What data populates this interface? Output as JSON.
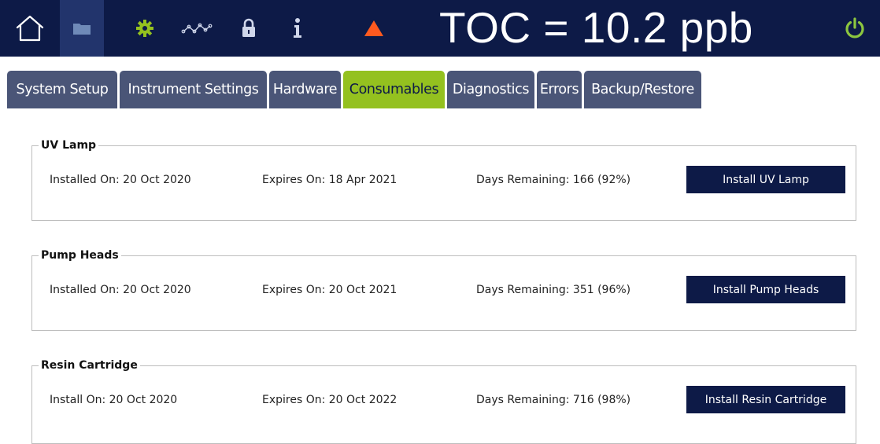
{
  "topbar": {
    "toc_reading": "TOC = 10.2 ppb",
    "icons": [
      "home-icon",
      "folder-icon",
      "gear-icon",
      "trend-icon",
      "lock-icon",
      "info-icon",
      "warning-icon",
      "power-icon"
    ],
    "colors": {
      "bar": "#0d1a47",
      "active_button": "#22346c",
      "gear": "#94c11f",
      "warning": "#ff5a1f",
      "power": "#8cc63f"
    }
  },
  "tabs": [
    {
      "label": "System Setup"
    },
    {
      "label": "Instrument Settings"
    },
    {
      "label": "Hardware"
    },
    {
      "label": "Consumables",
      "active": true
    },
    {
      "label": "Diagnostics"
    },
    {
      "label": "Errors"
    },
    {
      "label": "Backup/Restore"
    }
  ],
  "consumables": [
    {
      "title": "UV Lamp",
      "installed": "Installed On: 20 Oct 2020",
      "expires": "Expires On: 18 Apr 2021",
      "remaining": "Days Remaining: 166 (92%)",
      "button": "Install UV Lamp"
    },
    {
      "title": "Pump Heads",
      "installed": "Installed On: 20 Oct 2020",
      "expires": "Expires On: 20 Oct 2021",
      "remaining": "Days Remaining: 351 (96%)",
      "button": "Install Pump Heads"
    },
    {
      "title": "Resin Cartridge",
      "installed": "Install On: 20 Oct 2020",
      "expires": "Expires On: 20 Oct 2022",
      "remaining": "Days Remaining: 716 (98%)",
      "button": "Install Resin Cartridge"
    }
  ]
}
